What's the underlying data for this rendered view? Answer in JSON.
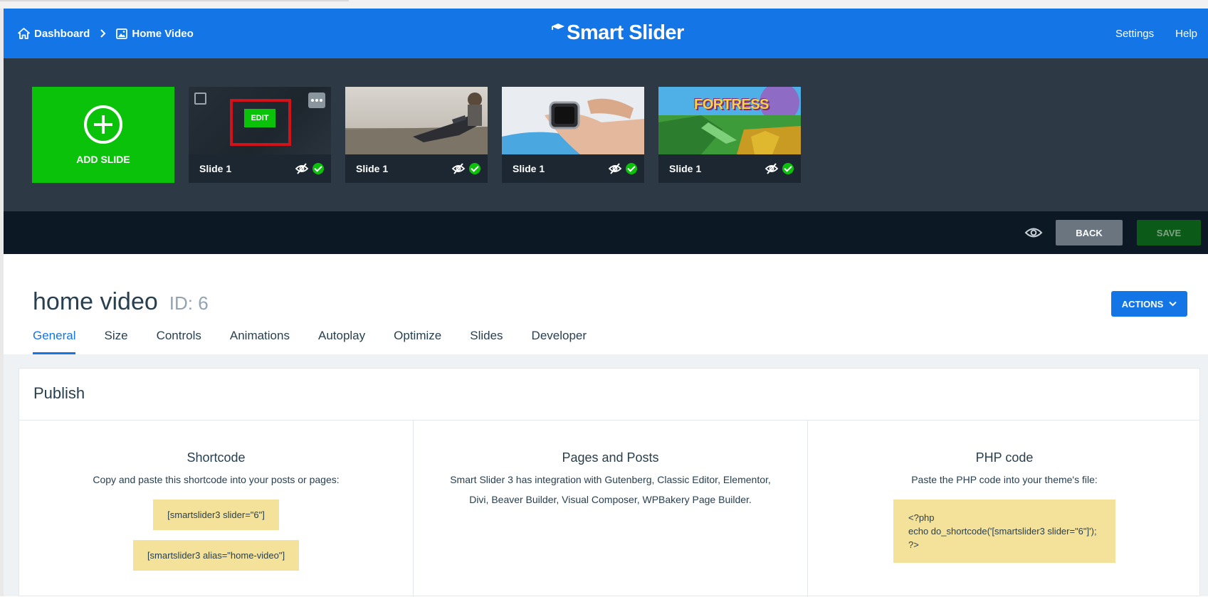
{
  "header": {
    "breadcrumbs": [
      {
        "label": "Dashboard",
        "icon": "home-icon"
      },
      {
        "label": "Home Video",
        "icon": "image-icon"
      }
    ],
    "logo": "Smart Slider",
    "links": {
      "settings": "Settings",
      "help": "Help"
    }
  },
  "slides": {
    "add_label": "ADD SLIDE",
    "edit_label": "EDIT",
    "items": [
      {
        "label": "Slide 1",
        "thumb": "dark"
      },
      {
        "label": "Slide 1",
        "thumb": "laptop"
      },
      {
        "label": "Slide 1",
        "thumb": "watch"
      },
      {
        "label": "Slide 1",
        "thumb": "fortress"
      }
    ],
    "fortress_text": "FORTRESS"
  },
  "toolbar": {
    "back_label": "BACK",
    "save_label": "SAVE"
  },
  "slider": {
    "title": "home video",
    "id_label": "ID: 6",
    "actions_label": "ACTIONS"
  },
  "tabs": [
    "General",
    "Size",
    "Controls",
    "Animations",
    "Autoplay",
    "Optimize",
    "Slides",
    "Developer"
  ],
  "publish": {
    "title": "Publish",
    "shortcode": {
      "title": "Shortcode",
      "desc": "Copy and paste this shortcode into your posts or pages:",
      "code1": "[smartslider3 slider=\"6\"]",
      "code2": "[smartslider3 alias=\"home-video\"]"
    },
    "pages": {
      "title": "Pages and Posts",
      "desc_line1": "Smart Slider 3 has integration with Gutenberg, Classic Editor, Elementor,",
      "desc_line2": "Divi, Beaver Builder, Visual Composer, WPBakery Page Builder."
    },
    "php": {
      "title": "PHP code",
      "desc": "Paste the PHP code into your theme's file:",
      "line1": "<?php",
      "line2": "echo do_shortcode('[smartslider3 slider=\"6\"]');",
      "line3": "?>"
    }
  },
  "colors": {
    "brand_blue": "#1375e6",
    "green": "#0ac20a",
    "dark": "#2d3a45",
    "code_bg": "#f5e29a"
  }
}
